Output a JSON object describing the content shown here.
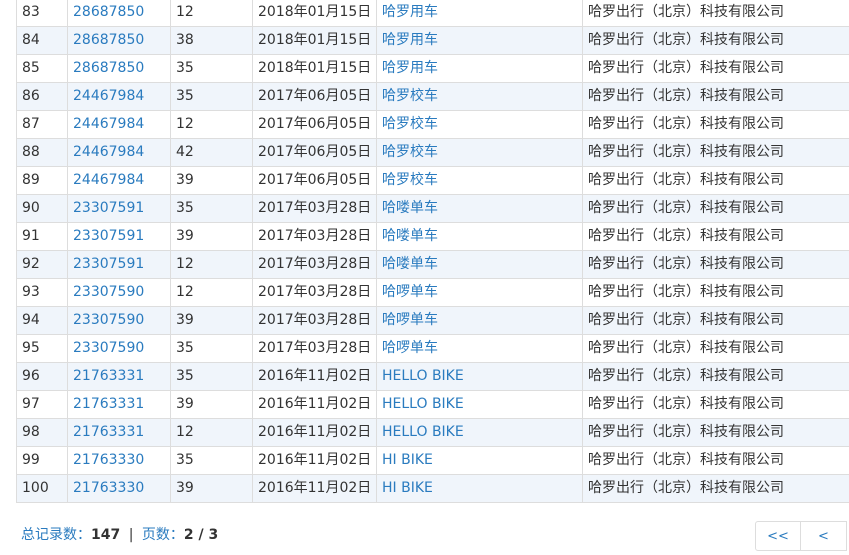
{
  "table": {
    "rows": [
      [
        "83",
        "28687850",
        "12",
        "2018年01月15日",
        "哈罗用车",
        "哈罗出行（北京）科技有限公司"
      ],
      [
        "84",
        "28687850",
        "38",
        "2018年01月15日",
        "哈罗用车",
        "哈罗出行（北京）科技有限公司"
      ],
      [
        "85",
        "28687850",
        "35",
        "2018年01月15日",
        "哈罗用车",
        "哈罗出行（北京）科技有限公司"
      ],
      [
        "86",
        "24467984",
        "35",
        "2017年06月05日",
        "哈罗校车",
        "哈罗出行（北京）科技有限公司"
      ],
      [
        "87",
        "24467984",
        "12",
        "2017年06月05日",
        "哈罗校车",
        "哈罗出行（北京）科技有限公司"
      ],
      [
        "88",
        "24467984",
        "42",
        "2017年06月05日",
        "哈罗校车",
        "哈罗出行（北京）科技有限公司"
      ],
      [
        "89",
        "24467984",
        "39",
        "2017年06月05日",
        "哈罗校车",
        "哈罗出行（北京）科技有限公司"
      ],
      [
        "90",
        "23307591",
        "35",
        "2017年03月28日",
        "哈喽单车",
        "哈罗出行（北京）科技有限公司"
      ],
      [
        "91",
        "23307591",
        "39",
        "2017年03月28日",
        "哈喽单车",
        "哈罗出行（北京）科技有限公司"
      ],
      [
        "92",
        "23307591",
        "12",
        "2017年03月28日",
        "哈喽单车",
        "哈罗出行（北京）科技有限公司"
      ],
      [
        "93",
        "23307590",
        "12",
        "2017年03月28日",
        "哈啰单车",
        "哈罗出行（北京）科技有限公司"
      ],
      [
        "94",
        "23307590",
        "39",
        "2017年03月28日",
        "哈啰单车",
        "哈罗出行（北京）科技有限公司"
      ],
      [
        "95",
        "23307590",
        "35",
        "2017年03月28日",
        "哈啰单车",
        "哈罗出行（北京）科技有限公司"
      ],
      [
        "96",
        "21763331",
        "35",
        "2016年11月02日",
        "HELLO BIKE",
        "哈罗出行（北京）科技有限公司"
      ],
      [
        "97",
        "21763331",
        "39",
        "2016年11月02日",
        "HELLO BIKE",
        "哈罗出行（北京）科技有限公司"
      ],
      [
        "98",
        "21763331",
        "12",
        "2016年11月02日",
        "HELLO BIKE",
        "哈罗出行（北京）科技有限公司"
      ],
      [
        "99",
        "21763330",
        "35",
        "2016年11月02日",
        "HI BIKE",
        "哈罗出行（北京）科技有限公司"
      ],
      [
        "100",
        "21763330",
        "39",
        "2016年11月02日",
        "HI BIKE",
        "哈罗出行（北京）科技有限公司"
      ]
    ]
  },
  "summary": {
    "total_label": "总记录数：",
    "total_value": "147",
    "separator": "|",
    "pages_label": "页数：",
    "pages_value": "2 / 3"
  },
  "pager": {
    "first_label": "<<",
    "prev_label": "<"
  },
  "colors": {
    "link": "#2a7bbf",
    "row_alt": "#f0f5fb",
    "border": "#dddddd"
  }
}
